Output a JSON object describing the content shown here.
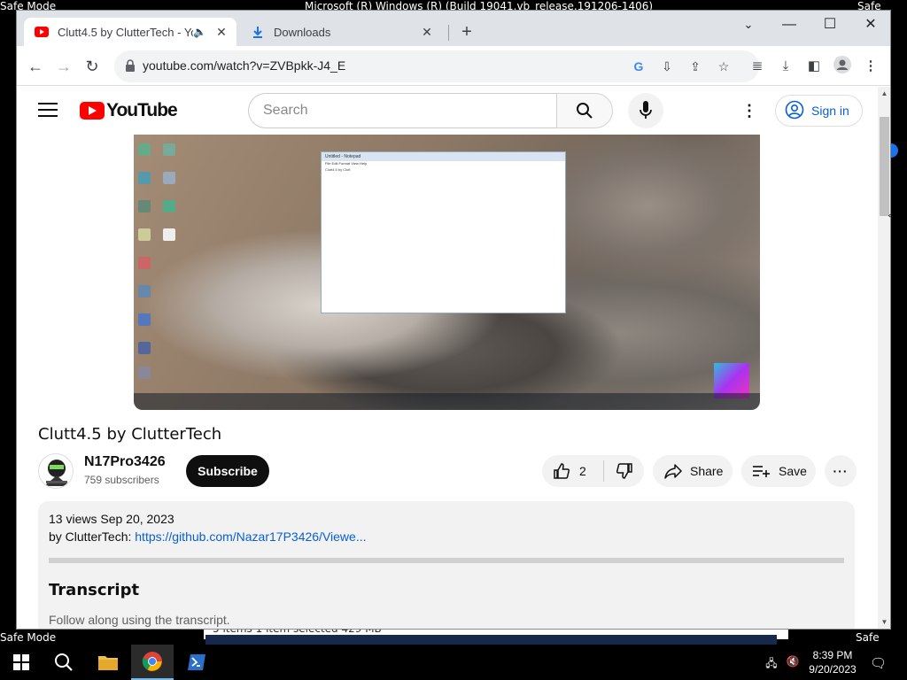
{
  "desktop": {
    "safe_mode": "Safe Mode",
    "build": "Microsoft (R) Windows (R) (Build 19041.vb_release.191206-1406)",
    "behind_status": "5 items     1 item selected  429 MB"
  },
  "browser": {
    "tabs": [
      {
        "title": "Clutt4.5 by ClutterTech - YouTube",
        "active": true
      },
      {
        "title": "Downloads",
        "active": false
      }
    ],
    "url": "youtube.com/watch?v=ZVBpkk-J4_E"
  },
  "youtube": {
    "logo_text": "YouTube",
    "search_placeholder": "Search",
    "sign_in": "Sign in",
    "video_title": "Clutt4.5 by ClutterTech",
    "notepad_title": "Untitled - Notepad",
    "notepad_menu": "File  Edit  Format  View  Help",
    "notepad_text": "Clutt4.5 by Clutt",
    "channel_name": "N17Pro3426",
    "subscribers": "759 subscribers",
    "subscribe": "Subscribe",
    "likes": "2",
    "share": "Share",
    "save": "Save",
    "views_date": "13 views  Sep 20, 2023",
    "desc_prefix": "by ClutterTech: ",
    "desc_link": "https://github.com/Nazar17P3426/Viewe...",
    "transcript_heading": "Transcript",
    "transcript_sub": "Follow along using the transcript."
  },
  "taskbar": {
    "time": "8:39 PM",
    "date": "9/20/2023"
  },
  "colors": {
    "yt_red": "#ff0000",
    "link_blue": "#065fd4"
  }
}
